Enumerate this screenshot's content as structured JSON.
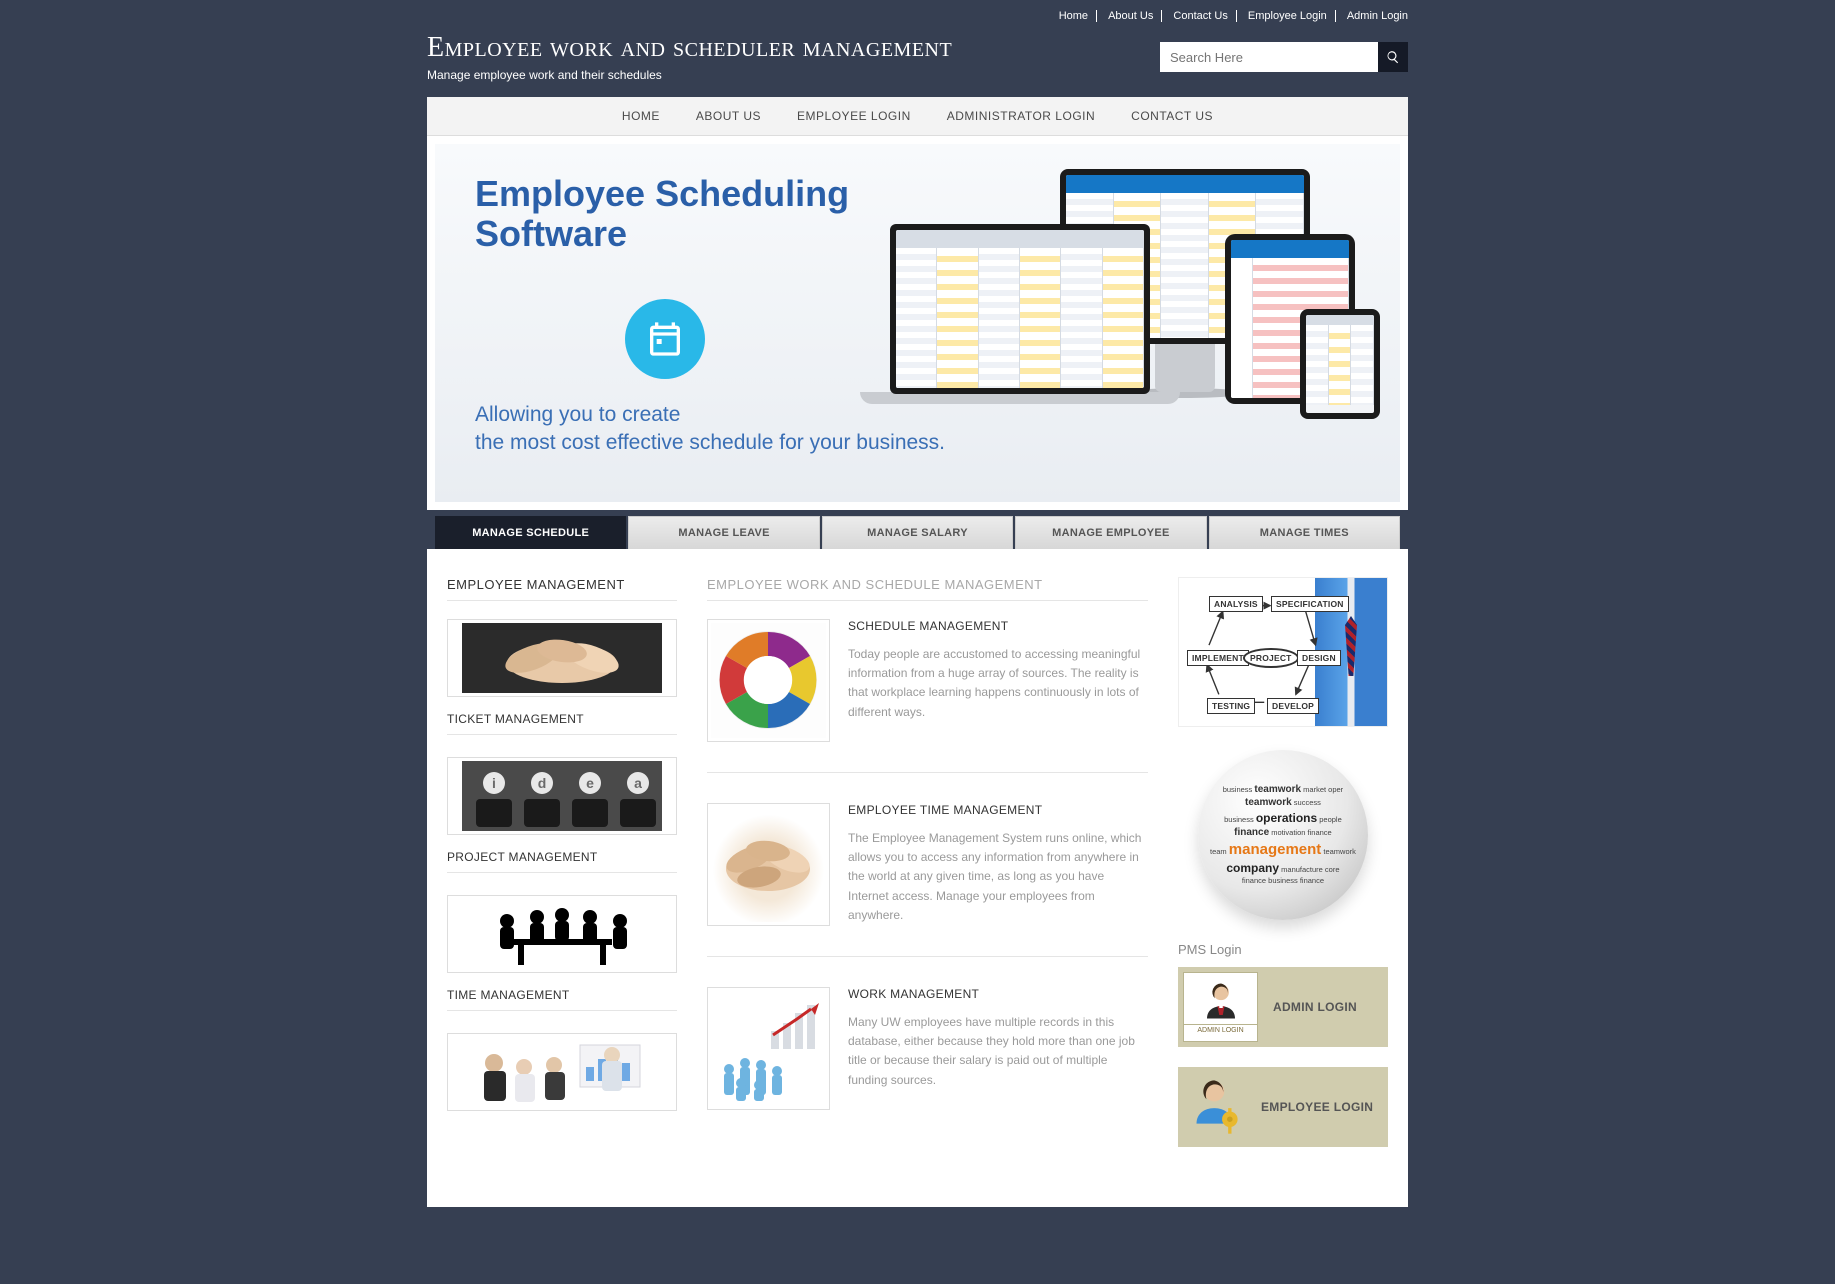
{
  "utilNav": [
    "Home",
    "About Us",
    "Contact Us",
    "Employee Login",
    "Admin Login"
  ],
  "brand": {
    "title": "Employee work and scheduler management",
    "subtitle": "Manage employee work and their schedules"
  },
  "search": {
    "placeholder": "Search Here"
  },
  "mainNav": [
    "HOME",
    "ABOUT US",
    "EMPLOYEE LOGIN",
    "ADMINISTRATOR LOGIN",
    "CONTACT US"
  ],
  "hero": {
    "title1": "Employee Scheduling",
    "title2": "Software",
    "sub1": "Allowing you to create",
    "sub2": "the most cost effective schedule for your business."
  },
  "tabs": {
    "active": 0,
    "items": [
      "MANAGE SCHEDULE",
      "MANAGE LEAVE",
      "MANAGE SALARY",
      "MANAGE EMPLOYEE",
      "MANAGE TIMES"
    ]
  },
  "left": {
    "heading": "EMPLOYEE MANAGEMENT",
    "blocks": [
      {
        "title": "TICKET MANAGEMENT"
      },
      {
        "title": "PROJECT MANAGEMENT"
      },
      {
        "title": "TIME MANAGEMENT"
      }
    ]
  },
  "mid": {
    "heading": "EMPLOYEE WORK AND SCHEDULE MANAGEMENT",
    "articles": [
      {
        "title": "SCHEDULE MANAGEMENT",
        "body": "Today people are accustomed to accessing meaningful information from a huge array of sources. The reality is that workplace learning happens continuously in lots of different ways."
      },
      {
        "title": "EMPLOYEE TIME MANAGEMENT",
        "body": "The Employee Management System runs online, which allows you to access any information from anywhere in the world at any given time, as long as you have Internet access. Manage your employees from anywhere."
      },
      {
        "title": "WORK MANAGEMENT",
        "body": "Many UW employees have multiple records in this database, either because they hold more than one job title or because their salary is paid out of multiple funding sources."
      }
    ]
  },
  "right": {
    "pmsHeading": "PMS Login",
    "adminLabel": "ADMIN LOGIN",
    "adminCaption": "ADMIN LOGIN",
    "employeeLabel": "EMPLOYEE LOGIN",
    "devNodes": {
      "analysis": "ANALYSIS",
      "specification": "SPECIFICATION",
      "implement": "IMPLEMENT",
      "project": "PROJECT",
      "design": "DESIGN",
      "testing": "TESTING",
      "develop": "DEVELOP"
    }
  }
}
